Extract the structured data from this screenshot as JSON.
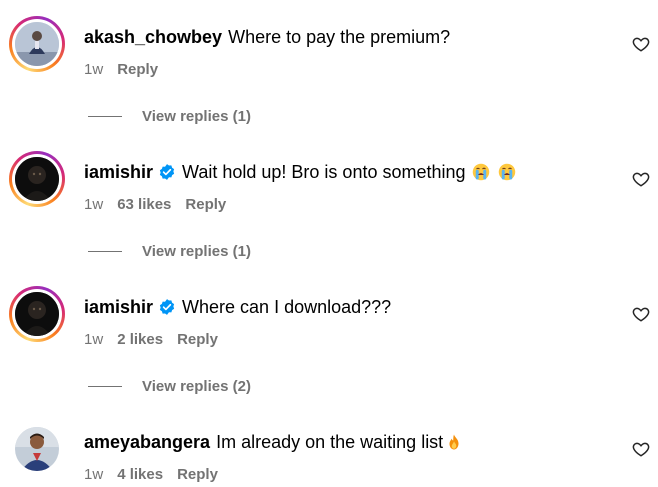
{
  "comments": [
    {
      "username": "akash_chowbey",
      "verified": false,
      "text": "Where to pay the premium?",
      "time": "1w",
      "likes": "",
      "reply": "Reply",
      "view_replies": "View replies (1)",
      "avatar_icon": "person-photo-avatar"
    },
    {
      "username": "iamishir",
      "verified": true,
      "text": "Wait hold up! Bro is onto something",
      "emoji": [
        "crying-face-emoji",
        "crying-face-emoji"
      ],
      "time": "1w",
      "likes": "63 likes",
      "reply": "Reply",
      "view_replies": "View replies (1)",
      "avatar_icon": "dark-portrait-avatar"
    },
    {
      "username": "iamishir",
      "verified": true,
      "text": "Where can I download???",
      "time": "1w",
      "likes": "2 likes",
      "reply": "Reply",
      "view_replies": "View replies (2)",
      "avatar_icon": "dark-portrait-avatar"
    },
    {
      "username": "ameyabangera",
      "verified": false,
      "text": "Im already on the waiting list",
      "emoji": [
        "fire-emoji"
      ],
      "time": "1w",
      "likes": "4 likes",
      "reply": "Reply",
      "view_replies": "",
      "avatar_icon": "person-photo-avatar"
    }
  ],
  "colors": {
    "text": "#000000",
    "secondary": "#737373",
    "verified": "#0095f6",
    "background": "#ffffff"
  }
}
